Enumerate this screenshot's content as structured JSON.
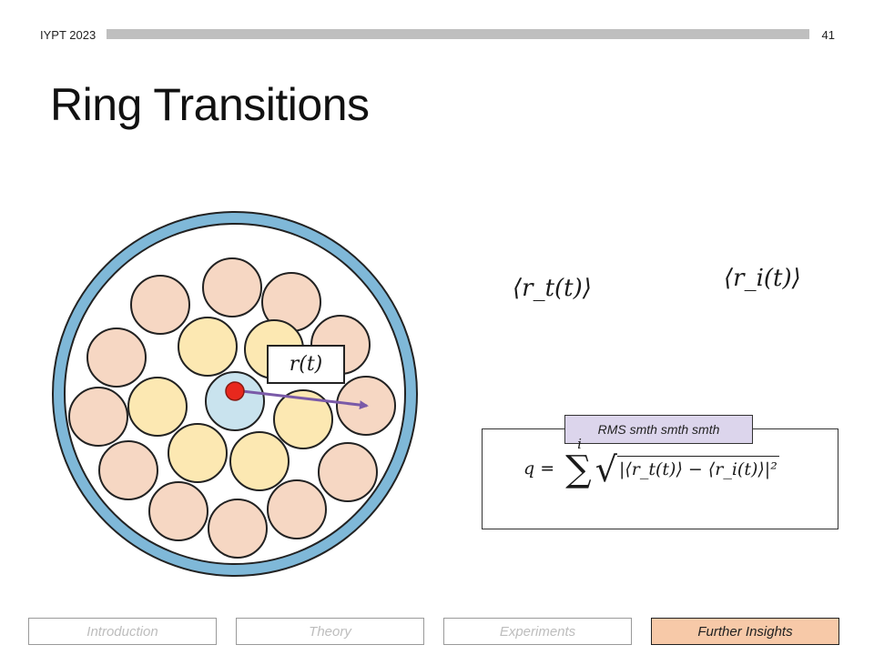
{
  "header": {
    "conference": "IYPT 2023",
    "slide_number": "41"
  },
  "title": "Ring Transitions",
  "diagram": {
    "position_label": "r(t)",
    "avg_label_t": "⟨r_t(t)⟩",
    "avg_label_i": "⟨r_i(t)⟩",
    "rms_tag": "RMS smth smth smth",
    "formula": {
      "lhs": "q =",
      "sum_upper": "i",
      "radicand": "|⟨r_t(t)⟩ − ⟨r_i(t)⟩|²"
    },
    "colors": {
      "ring": "#7fb8d8",
      "outer_disc": "#f6d7c3",
      "inner_disc": "#fce8b2",
      "center_disc": "#c9e3ee",
      "tracked_dot": "#e8281d",
      "arrow": "#7a5aa8",
      "rms_tag": "#dcd5ec",
      "active_nav": "#f7c9a8"
    }
  },
  "nav": {
    "items": [
      {
        "label": "Introduction",
        "active": false
      },
      {
        "label": "Theory",
        "active": false
      },
      {
        "label": "Experiments",
        "active": false
      },
      {
        "label": "Further Insights",
        "active": true
      }
    ]
  }
}
